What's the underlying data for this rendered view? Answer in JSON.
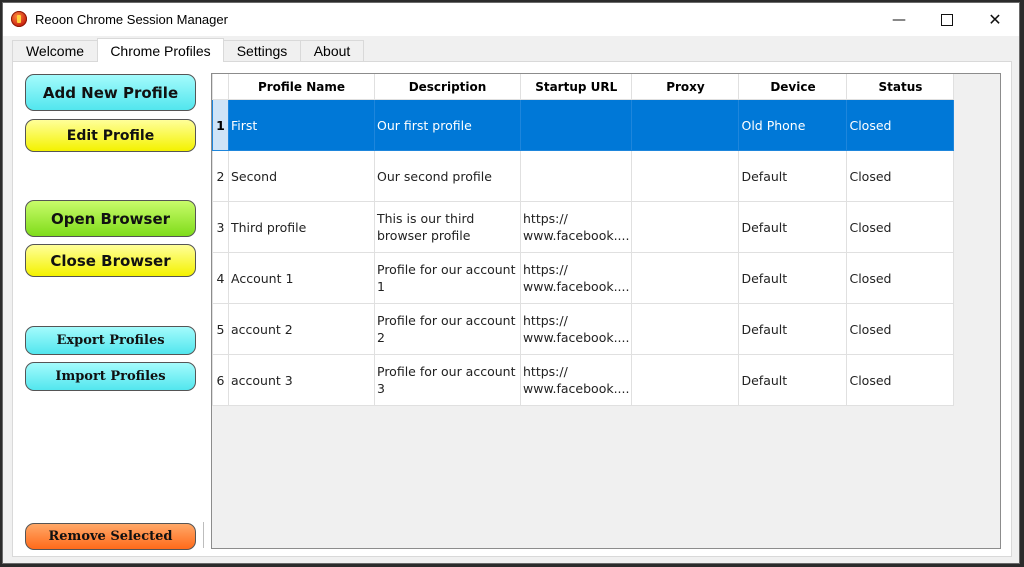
{
  "window": {
    "title": "Reoon Chrome Session Manager",
    "controls": {
      "minimize": "—",
      "close": "✕"
    }
  },
  "tabs": [
    {
      "label": "Welcome"
    },
    {
      "label": "Chrome Profiles",
      "active": true
    },
    {
      "label": "Settings"
    },
    {
      "label": "About"
    }
  ],
  "sidebar": {
    "add_profile": "Add New Profile",
    "edit_profile": "Edit Profile",
    "open_browser": "Open Browser",
    "close_browser": "Close Browser",
    "export_profiles": "Export Profiles",
    "import_profiles": "Import Profiles",
    "remove_selected": "Remove Selected"
  },
  "table": {
    "columns": [
      "Profile Name",
      "Description",
      "Startup URL",
      "Proxy",
      "Device",
      "Status"
    ],
    "rows": [
      {
        "num": "1",
        "name": "First",
        "description": "Our first profile",
        "url": "",
        "proxy": "",
        "device": "Old Phone",
        "status": "Closed",
        "selected": true
      },
      {
        "num": "2",
        "name": "Second",
        "description": "Our second profile",
        "url": "",
        "proxy": "",
        "device": "Default",
        "status": "Closed"
      },
      {
        "num": "3",
        "name": "Third profile",
        "description": "This is our third browser profile",
        "url": "https:// www.facebook....",
        "proxy": "",
        "device": "Default",
        "status": "Closed"
      },
      {
        "num": "4",
        "name": "Account 1",
        "description": "Profile for our account 1",
        "url": "https:// www.facebook....",
        "proxy": "",
        "device": "Default",
        "status": "Closed"
      },
      {
        "num": "5",
        "name": "account 2",
        "description": "Profile for our account 2",
        "url": "https:// www.facebook....",
        "proxy": "",
        "device": "Default",
        "status": "Closed"
      },
      {
        "num": "6",
        "name": "account 3",
        "description": "Profile for our account 3",
        "url": "https:// www.facebook....",
        "proxy": "",
        "device": "Default",
        "status": "Closed"
      }
    ]
  },
  "colors": {
    "selection": "#0078d7",
    "button_cyan": "#52e6ee",
    "button_yellow": "#f4f200",
    "button_green": "#7fdc1a",
    "button_orange": "#ff6a1a"
  }
}
